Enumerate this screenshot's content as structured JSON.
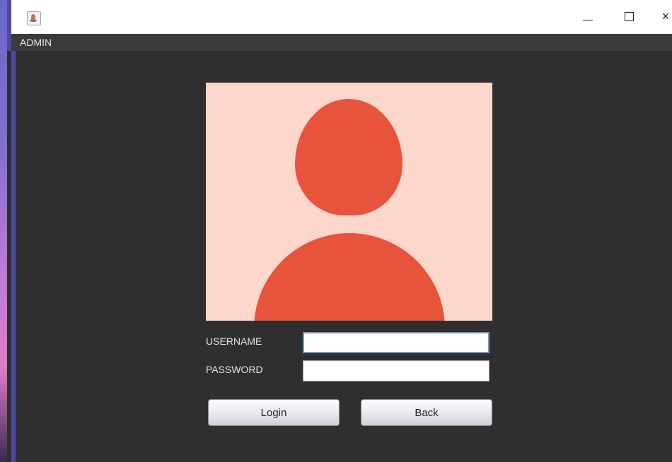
{
  "window": {
    "controls": {
      "minimize_icon": "minimize-icon",
      "maximize_icon": "maximize-icon",
      "close_glyph": "×"
    }
  },
  "menubar": {
    "items": [
      {
        "label": "ADMIN"
      }
    ]
  },
  "login_form": {
    "avatar_icon": "user-avatar-icon",
    "username_label": "USERNAME",
    "username_value": "",
    "password_label": "PASSWORD",
    "password_value": "",
    "login_label": "Login",
    "back_label": "Back"
  },
  "colors": {
    "background": "#2f2f2f",
    "avatar_bg": "#fdd7cb",
    "avatar_figure": "#e8533b",
    "label_text": "#e6e6e6"
  }
}
